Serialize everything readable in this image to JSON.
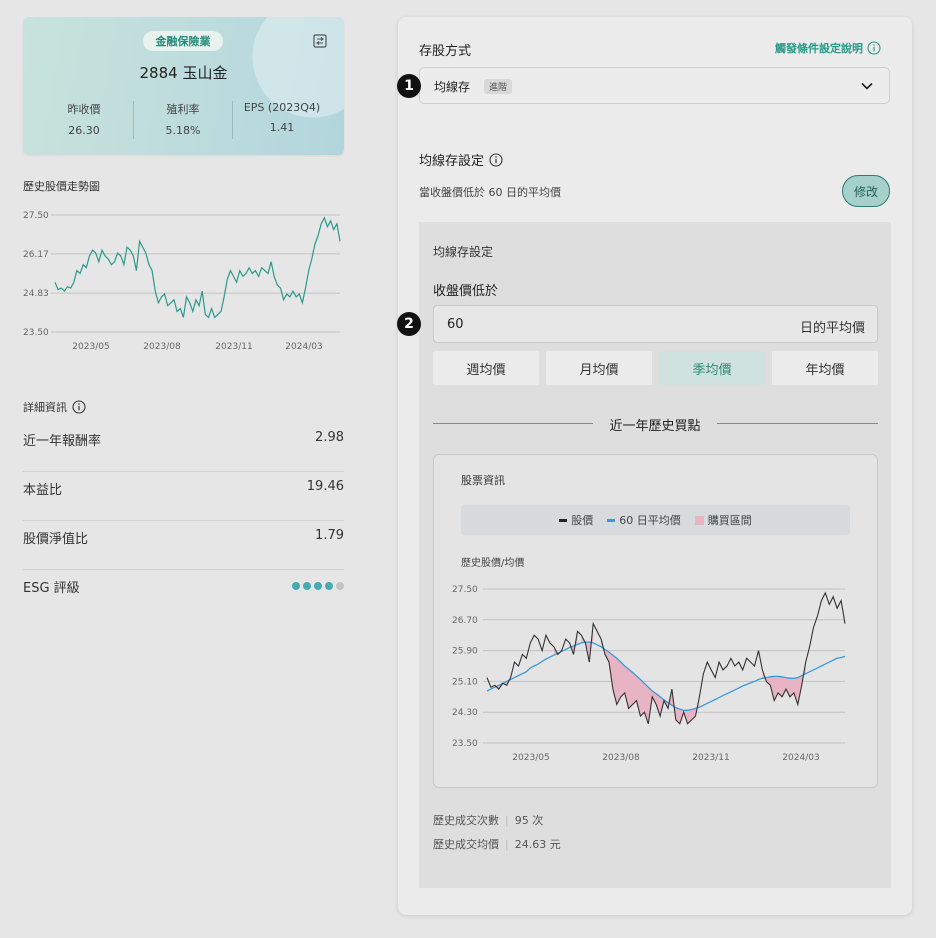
{
  "stock": {
    "industry": "金融保險業",
    "title": "2884 玉山金",
    "stats": [
      {
        "label": "昨收價",
        "value": "26.30"
      },
      {
        "label": "殖利率",
        "value": "5.18%"
      },
      {
        "label": "EPS (2023Q4)",
        "value": "1.41"
      }
    ]
  },
  "mini_chart": {
    "title": "歷史股價走勢圖",
    "y_ticks": [
      "27.50",
      "26.17",
      "24.83",
      "23.50"
    ],
    "x_ticks": [
      "2023/05",
      "2023/08",
      "2023/11",
      "2024/03"
    ]
  },
  "details": {
    "title": "詳細資訊",
    "rows": [
      {
        "label": "近一年報酬率",
        "value": "2.98"
      },
      {
        "label": "本益比",
        "value": "19.46"
      },
      {
        "label": "股價淨值比",
        "value": "1.79"
      },
      {
        "label": "ESG 評級",
        "value": ""
      }
    ],
    "esg_dots_filled": 4,
    "esg_dots_total": 5
  },
  "panel": {
    "method_label": "存股方式",
    "help_link": "觸發條件設定說明",
    "dropdown_value": "均線存",
    "dropdown_tag": "進階",
    "ma_setting_title": "均線存設定",
    "ma_setting_desc": "當收盤價低於 60 日的平均價",
    "edit_button": "修改",
    "inner_title": "均線存設定",
    "below_label": "收盤價低於",
    "input_value": "60",
    "input_suffix": "日的平均價",
    "segments": [
      "週均價",
      "月均價",
      "季均價",
      "年均價"
    ],
    "active_segment": "季均價",
    "history_divider": "近一年歷史買點",
    "markers": [
      "1",
      "2"
    ]
  },
  "chart_card": {
    "title": "股票資訊",
    "legend": [
      "股價",
      "60 日平均價",
      "購買區間"
    ],
    "ylabel": "歷史股價/均價",
    "summary": [
      {
        "label": "歷史成交次數",
        "value": "95 次"
      },
      {
        "label": "歷史成交均價",
        "value": "24.63 元"
      }
    ]
  },
  "colors": {
    "accent": "#2a9a86",
    "price_line_mini": "#2a9a8c",
    "price_line": "#333333",
    "ma_line": "#3a9ad9",
    "buy_zone": "#e8b4c4"
  },
  "chart_data": [
    {
      "type": "line",
      "title": "歷史股價走勢圖",
      "x_ticks": [
        "2023/05",
        "2023/08",
        "2023/11",
        "2024/03"
      ],
      "ylim": [
        23.5,
        27.5
      ],
      "y_ticks": [
        27.5,
        26.17,
        24.83,
        23.5
      ],
      "series": [
        {
          "values": [
            25.2,
            24.95,
            25.0,
            24.9,
            25.05,
            25.0,
            25.2,
            25.6,
            25.5,
            25.8,
            25.7,
            26.1,
            26.3,
            26.2,
            25.9,
            26.3,
            26.1,
            26.0,
            25.8,
            25.9,
            26.2,
            26.1,
            25.8,
            26.4,
            26.3,
            26.1,
            25.6,
            26.6,
            26.4,
            26.2,
            25.8,
            25.6,
            24.9,
            24.5,
            24.7,
            24.8,
            24.4,
            24.5,
            24.6,
            24.2,
            24.3,
            24.0,
            24.7,
            24.5,
            24.2,
            24.6,
            24.4,
            24.9,
            24.1,
            24.0,
            24.3,
            24.0,
            24.1,
            24.2,
            24.7,
            25.3,
            25.6,
            25.4,
            25.2,
            25.6,
            25.4,
            25.5,
            25.7,
            25.5,
            25.6,
            25.4,
            25.7,
            25.6,
            25.5,
            25.9,
            25.4,
            25.1,
            25.0,
            24.6,
            24.8,
            24.7,
            24.9,
            24.7,
            24.8,
            24.5,
            25.0,
            25.6,
            26.0,
            26.5,
            26.8,
            27.2,
            27.4,
            27.1,
            27.3,
            27.0,
            27.2,
            26.6
          ]
        }
      ]
    },
    {
      "type": "line",
      "title": "股票資訊",
      "ylabel": "歷史股價/均價",
      "x_ticks": [
        "2023/05",
        "2023/08",
        "2023/11",
        "2024/03"
      ],
      "ylim": [
        23.5,
        27.5
      ],
      "y_ticks": [
        27.5,
        26.7,
        25.9,
        25.1,
        24.3,
        23.5
      ],
      "series": [
        {
          "name": "股價",
          "values": [
            25.2,
            24.95,
            25.0,
            24.9,
            25.05,
            25.0,
            25.2,
            25.6,
            25.5,
            25.8,
            25.7,
            26.1,
            26.3,
            26.2,
            25.9,
            26.3,
            26.1,
            26.0,
            25.8,
            25.9,
            26.2,
            26.1,
            25.8,
            26.4,
            26.3,
            26.1,
            25.6,
            26.6,
            26.4,
            26.2,
            25.8,
            25.6,
            24.9,
            24.5,
            24.7,
            24.8,
            24.4,
            24.5,
            24.6,
            24.2,
            24.3,
            24.0,
            24.7,
            24.5,
            24.2,
            24.6,
            24.4,
            24.9,
            24.1,
            24.0,
            24.3,
            24.0,
            24.1,
            24.2,
            24.7,
            25.3,
            25.6,
            25.4,
            25.2,
            25.6,
            25.4,
            25.5,
            25.7,
            25.5,
            25.6,
            25.4,
            25.7,
            25.6,
            25.5,
            25.9,
            25.4,
            25.1,
            25.0,
            24.6,
            24.8,
            24.7,
            24.9,
            24.7,
            24.8,
            24.5,
            25.0,
            25.6,
            26.0,
            26.5,
            26.8,
            27.2,
            27.4,
            27.1,
            27.3,
            27.0,
            27.2,
            26.6
          ]
        },
        {
          "name": "60 日平均價",
          "values": [
            24.85,
            24.9,
            24.95,
            25.0,
            25.05,
            25.1,
            25.15,
            25.2,
            25.25,
            25.3,
            25.35,
            25.45,
            25.5,
            25.55,
            25.62,
            25.68,
            25.73,
            25.78,
            25.83,
            25.88,
            25.93,
            25.98,
            26.02,
            26.06,
            26.1,
            26.12,
            26.12,
            26.1,
            26.05,
            26.0,
            25.93,
            25.86,
            25.78,
            25.7,
            25.6,
            25.5,
            25.42,
            25.33,
            25.24,
            25.15,
            25.05,
            24.95,
            24.85,
            24.78,
            24.7,
            24.62,
            24.55,
            24.48,
            24.42,
            24.38,
            24.35,
            24.35,
            24.37,
            24.4,
            24.43,
            24.48,
            24.53,
            24.58,
            24.63,
            24.68,
            24.73,
            24.78,
            24.83,
            24.88,
            24.93,
            24.98,
            25.02,
            25.06,
            25.1,
            25.15,
            25.18,
            25.2,
            25.22,
            25.23,
            25.23,
            25.22,
            25.2,
            25.18,
            25.18,
            25.2,
            25.25,
            25.3,
            25.35,
            25.4,
            25.45,
            25.5,
            25.55,
            25.6,
            25.65,
            25.7,
            25.72,
            25.75
          ]
        },
        {
          "name": "購買區間",
          "values": []
        }
      ]
    }
  ]
}
